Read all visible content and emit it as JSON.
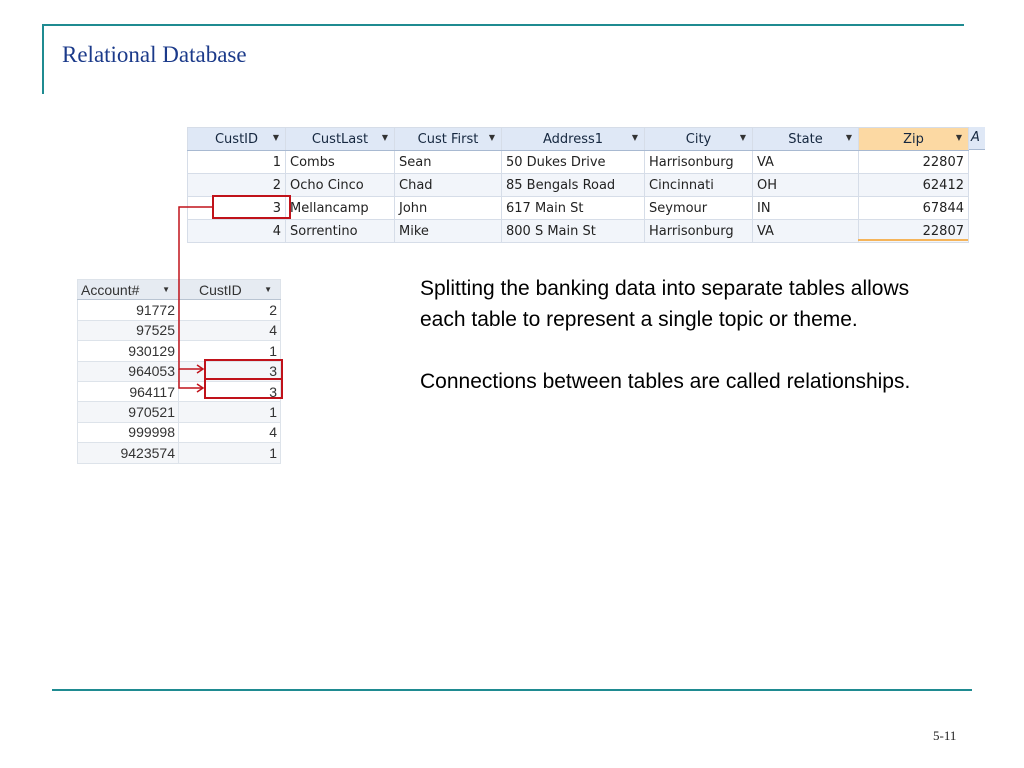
{
  "slide": {
    "title": "Relational Database",
    "number": "5-11"
  },
  "customers_table": {
    "columns": [
      "CustID",
      "CustLast",
      "Cust First",
      "Address1",
      "City",
      "State",
      "Zip"
    ],
    "partial_column": "A",
    "rows": [
      {
        "CustID": "1",
        "CustLast": "Combs",
        "CustFirst": "Sean",
        "Address1": "50 Dukes Drive",
        "City": "Harrisonburg",
        "State": "VA",
        "Zip": "22807"
      },
      {
        "CustID": "2",
        "CustLast": "Ocho Cinco",
        "CustFirst": "Chad",
        "Address1": "85 Bengals Road",
        "City": "Cincinnati",
        "State": "OH",
        "Zip": "62412"
      },
      {
        "CustID": "3",
        "CustLast": "Mellancamp",
        "CustFirst": "John",
        "Address1": "617 Main St",
        "City": "Seymour",
        "State": "IN",
        "Zip": "67844"
      },
      {
        "CustID": "4",
        "CustLast": "Sorrentino",
        "CustFirst": "Mike",
        "Address1": "800 S Main St",
        "City": "Harrisonburg",
        "State": "VA",
        "Zip": "22807"
      }
    ],
    "highlighted_custid": "3"
  },
  "accounts_table": {
    "columns": [
      "Account#",
      "CustID"
    ],
    "rows": [
      {
        "Account": "91772",
        "CustID": "2"
      },
      {
        "Account": "97525",
        "CustID": "4"
      },
      {
        "Account": "930129",
        "CustID": "1"
      },
      {
        "Account": "964053",
        "CustID": "3"
      },
      {
        "Account": "964117",
        "CustID": "3"
      },
      {
        "Account": "970521",
        "CustID": "1"
      },
      {
        "Account": "999998",
        "CustID": "4"
      },
      {
        "Account": "9423574",
        "CustID": "1"
      }
    ]
  },
  "notes": {
    "paragraph1": "Splitting the banking data into separate tables allows each table to represent a single topic or theme.",
    "paragraph2": "Connections between tables are called relationships."
  },
  "colors": {
    "accent_line": "#1f8b91",
    "title": "#1b3a8a",
    "highlight": "#c0121a",
    "header_blue": "#dfe8f6",
    "header_sorted": "#fcd9a3"
  }
}
